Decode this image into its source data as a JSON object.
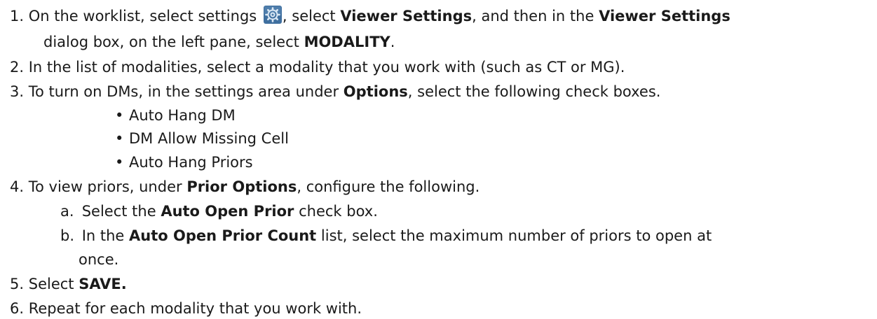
{
  "colors": {
    "text": "#1a1a1a",
    "gear_icon_bg": "#3f6f9f",
    "gear_icon_fg": "#dbe8f4"
  },
  "steps": [
    {
      "num": "1.",
      "l1_a": "On the worklist, select settings",
      "icon": "gear-settings-icon",
      "l1_b": ", select",
      "l1_c": "Viewer Settings",
      "l1_d": ", and then in the",
      "l1_e": "Viewer Settings",
      "l2_a": "dialog box, on the left pane, select",
      "l2_b": "MODALITY",
      "l2_c": "."
    },
    {
      "num": "2.",
      "text": "In the list of modalities, select a modality that you work with (such as CT or MG)."
    },
    {
      "num": "3.",
      "a": "To turn on DMs, in the settings area under",
      "b": "Options",
      "c": ", select the following check boxes.",
      "bullets": [
        "Auto Hang DM",
        "DM Allow Missing Cell",
        "Auto Hang Priors"
      ]
    },
    {
      "num": "4.",
      "a": "To view priors, under",
      "b": "Prior Options",
      "c": ", configure the following.",
      "sub": [
        {
          "letter": "a.",
          "a": "Select the",
          "b": "Auto Open Prior",
          "c": "check box."
        },
        {
          "letter": "b.",
          "a": "In the",
          "b": "Auto Open Prior Count",
          "c": "list, select the maximum number of priors to open at",
          "cont": "once."
        }
      ]
    },
    {
      "num": "5.",
      "a": "Select",
      "b": "SAVE."
    },
    {
      "num": "6.",
      "text": "Repeat for each modality that you work with."
    }
  ]
}
